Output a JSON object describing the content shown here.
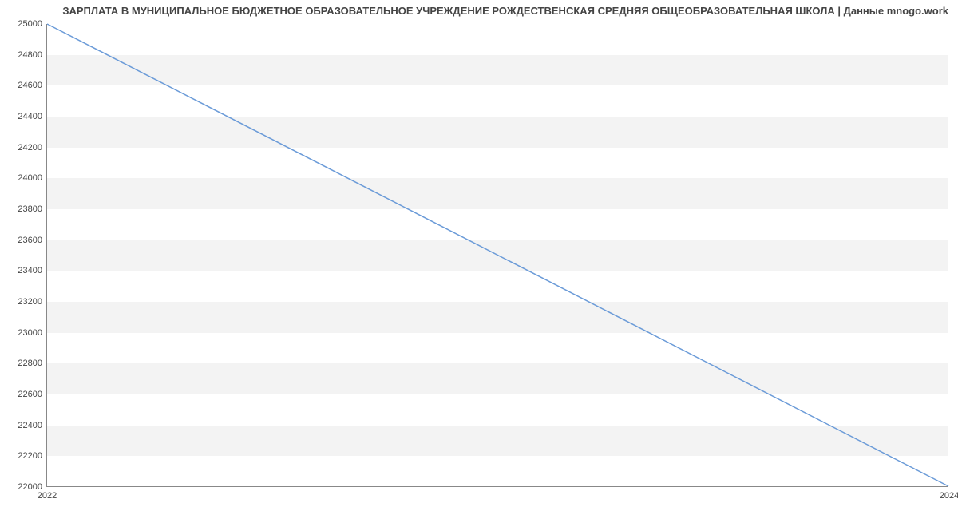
{
  "chart_data": {
    "type": "line",
    "title": "ЗАРПЛАТА В МУНИЦИПАЛЬНОЕ БЮДЖЕТНОЕ ОБРАЗОВАТЕЛЬНОЕ УЧРЕЖДЕНИЕ РОЖДЕСТВЕНСКАЯ СРЕДНЯЯ ОБЩЕОБРАЗОВАТЕЛЬНАЯ ШКОЛА | Данные mnogo.work",
    "xlabel": "",
    "ylabel": "",
    "x": [
      2022,
      2024
    ],
    "values": [
      25000,
      22000
    ],
    "xlim": [
      2022,
      2024
    ],
    "ylim": [
      22000,
      25000
    ],
    "xticks": [
      2022,
      2024
    ],
    "yticks": [
      22000,
      22200,
      22400,
      22600,
      22800,
      23000,
      23200,
      23400,
      23600,
      23800,
      24000,
      24200,
      24400,
      24600,
      24800,
      25000
    ],
    "grid": true,
    "line_color": "#6b9bd8"
  }
}
